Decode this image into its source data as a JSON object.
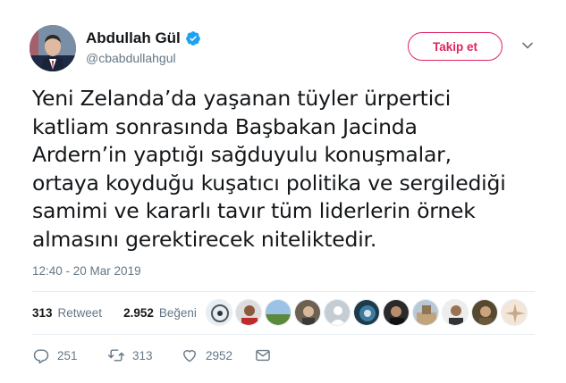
{
  "user": {
    "name": "Abdullah Gül",
    "handle": "@cbabdullahgul",
    "verified": true
  },
  "follow_button": {
    "label": "Takip et"
  },
  "menu": {
    "icon": "chevron-down-icon"
  },
  "tweet": {
    "lines": [
      "Yeni Zelanda’da yaşanan tüyler ürpertici",
      "katliam sonrasında Başbakan Jacinda",
      "Ardern’in yaptığı sağduyulu konuşmalar,",
      "ortaya koyduğu kuşatıcı politika ve sergilediği",
      "samimi ve kararlı tavır tüm liderlerin örnek",
      "almasını gerektirecek niteliktedir."
    ],
    "timestamp": "12:40 - 20 Mar 2019"
  },
  "stats": {
    "retweets_count": "313",
    "retweets_label": "Retweet",
    "likes_count": "2.952",
    "likes_label": "Beğeni"
  },
  "actions": {
    "reply_count": "251",
    "retweet_count": "313",
    "like_count": "2952"
  },
  "colors": {
    "accent": "#e0245e",
    "verified": "#1da1f2",
    "muted": "#657786",
    "divider": "#e6ecf0"
  }
}
